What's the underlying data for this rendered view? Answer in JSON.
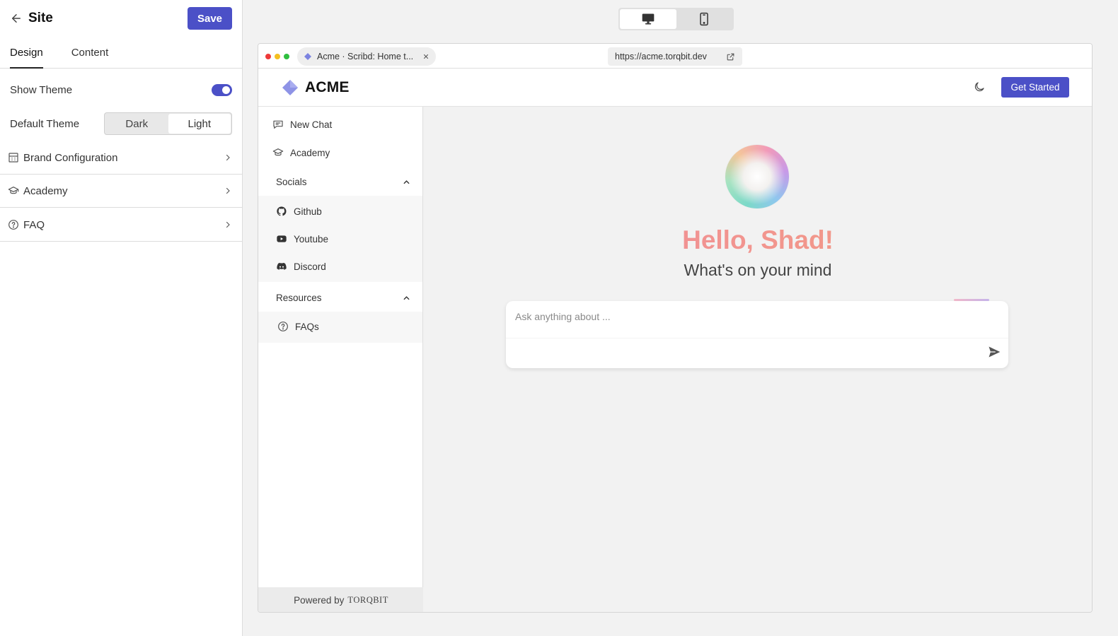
{
  "panel": {
    "title": "Site",
    "save_label": "Save",
    "tabs": [
      {
        "label": "Design",
        "active": true
      },
      {
        "label": "Content",
        "active": false
      }
    ],
    "show_theme": {
      "label": "Show Theme",
      "on": true
    },
    "default_theme": {
      "label": "Default Theme",
      "options": [
        "Dark",
        "Light"
      ],
      "selected": "Light"
    },
    "sections": [
      {
        "label": "Brand Configuration",
        "icon": "building-icon"
      },
      {
        "label": "Academy",
        "icon": "graduation-cap-icon"
      },
      {
        "label": "FAQ",
        "icon": "help-circle-icon"
      }
    ]
  },
  "device_toggle": {
    "options": [
      "desktop",
      "mobile"
    ],
    "selected": "desktop"
  },
  "browser": {
    "tab_title": "Acme · Scribd: Home t...",
    "url": "https://acme.torqbit.dev"
  },
  "site": {
    "brand_name": "ACME",
    "cta_label": "Get Started",
    "accent_color": "#4b50c7",
    "sidebar": {
      "items": [
        {
          "label": "New Chat",
          "icon": "message-square-icon"
        },
        {
          "label": "Academy",
          "icon": "graduation-cap-icon"
        }
      ],
      "socials": {
        "label": "Socials",
        "items": [
          {
            "label": "Github",
            "icon": "github-icon"
          },
          {
            "label": "Youtube",
            "icon": "youtube-icon"
          },
          {
            "label": "Discord",
            "icon": "discord-icon"
          }
        ]
      },
      "resources": {
        "label": "Resources",
        "items": [
          {
            "label": "FAQs",
            "icon": "help-circle-icon"
          }
        ]
      },
      "powered_by": "Powered by",
      "powered_brand": "TORQBIT"
    },
    "main": {
      "greeting": "Hello, Shad!",
      "subtitle": "What's on your mind",
      "input_placeholder": "Ask anything about ..."
    }
  }
}
